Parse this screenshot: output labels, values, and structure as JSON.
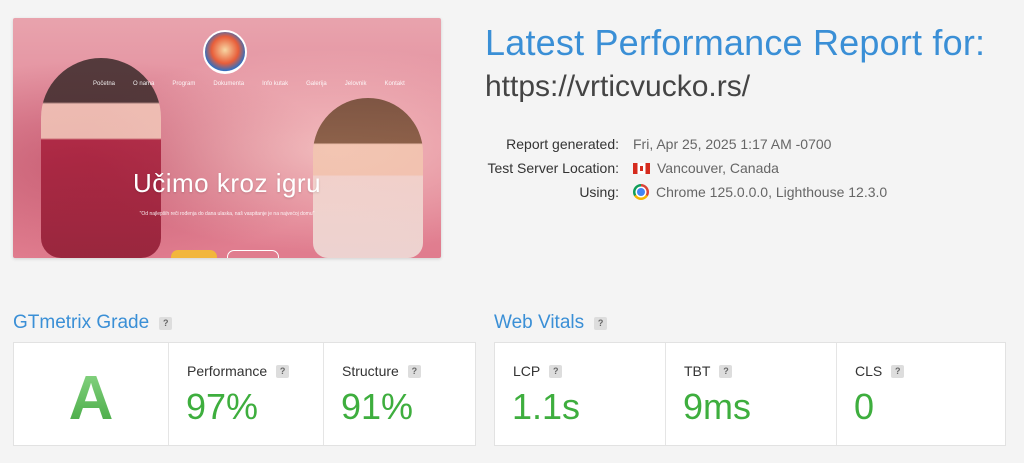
{
  "thumbnail": {
    "nav_items": [
      "Početna",
      "O nama",
      "Program",
      "Dokumenta",
      "Info kutak",
      "Galerija",
      "Jelovnik",
      "Kontakt"
    ],
    "headline": "Učimo kroz igru",
    "subtext": "\"Od najlepših reči rođenja do dana ulaska, naš vaspitanje je na najvećoj domu\""
  },
  "report": {
    "title": "Latest Performance Report for:",
    "url": "https://vrticvucko.rs/",
    "meta": [
      {
        "label": "Report generated:",
        "value": "Fri, Apr 25, 2025 1:17 AM -0700",
        "icon": ""
      },
      {
        "label": "Test Server Location:",
        "value": "Vancouver, Canada",
        "icon": "canada-flag-icon"
      },
      {
        "label": "Using:",
        "value": "Chrome 125.0.0.0, Lighthouse 12.3.0",
        "icon": "chrome-icon"
      }
    ]
  },
  "grade_section": {
    "title": "GTmetrix Grade",
    "help": "?",
    "grade": "A",
    "performance_label": "Performance",
    "performance_value": "97%",
    "structure_label": "Structure",
    "structure_value": "91%"
  },
  "vitals_section": {
    "title": "Web Vitals",
    "help": "?",
    "lcp_label": "LCP",
    "lcp_value": "1.1s",
    "tbt_label": "TBT",
    "tbt_value": "9ms",
    "cls_label": "CLS",
    "cls_value": "0"
  },
  "colors": {
    "accent": "#3a8fd6",
    "good": "#3eae3e"
  }
}
